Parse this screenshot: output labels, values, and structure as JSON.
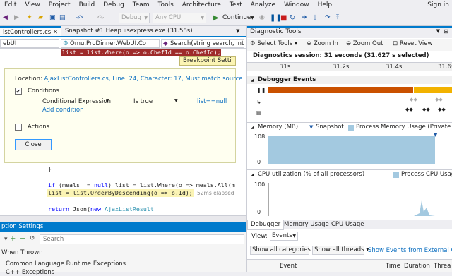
{
  "menu": [
    "Edit",
    "View",
    "Project",
    "Build",
    "Debug",
    "Team",
    "Tools",
    "Architecture",
    "Test",
    "Analyze",
    "Window",
    "Help"
  ],
  "signin": "Sign in",
  "toolbar": {
    "config": "Debug",
    "platform": "Any CPU",
    "continue": "Continue"
  },
  "doc_tabs": [
    {
      "label": "istControllers.cs",
      "close": "✕"
    },
    {
      "label": "Snapshot #1 Heap iisexpress.exe (31.58s)"
    }
  ],
  "nav": {
    "project": "ebUI",
    "type": "Omu.ProDinner.WebUI.Co",
    "member": "Search(string search, int?"
  },
  "code": {
    "line1": "list = list.Where(o => o.ChefId == o.ChefId);",
    "brace": "}",
    "line_if_a": "if",
    "line_if_b": " (meals != ",
    "line_if_null": "null",
    "line_if_c": ") list = list.Where(o => meals.All(m",
    "line_order": "list = list.OrderByDescending(o => o.Id);",
    "elapsed": "52ms elapsed",
    "line_ret_a": "return",
    "line_ret_b": " Json(",
    "line_ret_new": "new",
    "line_ret_c": " ",
    "line_ret_type": "AjaxListResult"
  },
  "breakpoint": {
    "badge": "Breakpoint Setti",
    "location_prefix": "Location: ",
    "location_link": "AjaxListControllers.cs, Line: 24, Character: 17, Must match source",
    "conditions_label": "Conditions",
    "cond_type": "Conditional Expression",
    "cond_op": "Is true",
    "cond_value": "list==null",
    "add_condition": "Add condition",
    "actions_label": "Actions",
    "close_button": "Close"
  },
  "exception_settings": {
    "title": "ption Settings",
    "search_placeholder": "Search",
    "header": "When Thrown",
    "rows": [
      "Common Language Runtime Exceptions",
      "C++ Exceptions"
    ]
  },
  "diag": {
    "title": "Diagnostic Tools",
    "select_tools": "Select Tools",
    "zoom_in": "Zoom In",
    "zoom_out": "Zoom Out",
    "reset_view": "Reset View",
    "session": "Diagnostics session: 31 seconds (31.627 s selected)",
    "ticks": [
      "31s",
      "31.2s",
      "31.4s",
      "31.6s"
    ],
    "debugger_events": "Debugger Events",
    "memory_title": "Memory (MB)",
    "snapshot_legend": "Snapshot",
    "memory_legend": "Process Memory Usage (Private Byte",
    "mem_y_top": "108",
    "mem_y_bottom": "0",
    "cpu_title": "CPU utilization (% of all processors)",
    "cpu_legend": "Process CPU Usag",
    "cpu_y_top": "100",
    "cpu_y_bottom": "0",
    "tabs": [
      "Debugger",
      "Memory Usage",
      "CPU Usage"
    ],
    "view_label": "View:",
    "view_value": "Events",
    "filter_categories": "Show all categories",
    "filter_threads": "Show all threads",
    "filter_external": "Show Events from External Code",
    "col_event": "Event",
    "col_time": "Time",
    "col_duration": "Duration",
    "col_thread": "Threa"
  },
  "colors": {
    "accent": "#007acc",
    "event_bar": "#ca5100",
    "event_bar_gold": "#f2b200",
    "highlight": "#fbf4b4",
    "memory_fill": "#a3c9e0"
  }
}
